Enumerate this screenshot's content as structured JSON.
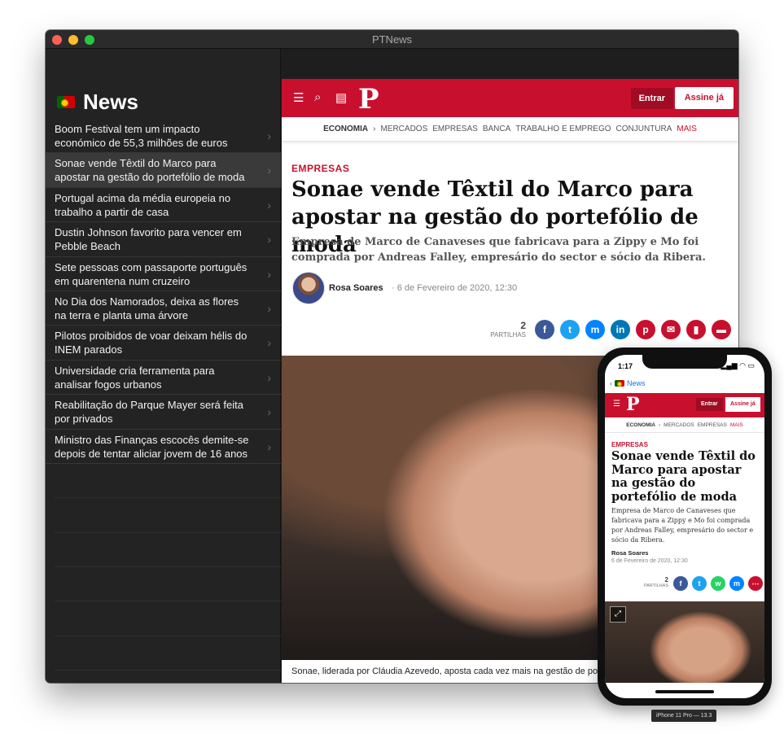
{
  "window": {
    "title": "PTNews"
  },
  "colors": {
    "brand_red": "#c8102e",
    "sidebar_bg": "#232323"
  },
  "sidebar": {
    "title": "News",
    "items": [
      {
        "label": "Boom Festival tem um impacto económico de 55,3 milhões de euros"
      },
      {
        "label": "Sonae vende Têxtil do Marco para apostar na gestão do portefólio de moda",
        "selected": true
      },
      {
        "label": "Portugal acima da média europeia no trabalho a partir de casa"
      },
      {
        "label": "Dustin Johnson favorito para vencer em Pebble Beach"
      },
      {
        "label": "Sete pessoas com passaporte português em quarentena num cruzeiro"
      },
      {
        "label": "No Dia dos Namorados, deixa as flores na terra e planta uma árvore"
      },
      {
        "label": "Pilotos proibidos de voar deixam hélis do INEM parados"
      },
      {
        "label": "Universidade cria ferramenta para analisar fogos urbanos"
      },
      {
        "label": "Reabilitação do Parque Mayer será feita por privados"
      },
      {
        "label": "Ministro das Finanças escocês demite-se depois de tentar aliciar jovem de 16 anos"
      }
    ]
  },
  "site": {
    "logo": "P",
    "entrar": "Entrar",
    "assine": "Assine já",
    "subnav": [
      "ECONOMIA",
      "›",
      "MERCADOS",
      "EMPRESAS",
      "BANCA",
      "TRABALHO E EMPREGO",
      "CONJUNTURA",
      "MAIS"
    ]
  },
  "article": {
    "kicker": "EMPRESAS",
    "headline": "Sonae vende Têxtil do Marco para apostar na gestão do portefólio de moda",
    "standfirst": "Empresa de Marco de Canaveses que fabricava para a Zippy e Mo foi comprada por Andreas Falley, empresário do sector e sócio da Ribera.",
    "author": "Rosa Soares",
    "date": "· 6 de Fevereiro de 2020, 12:30",
    "share_count": "2",
    "share_label": "PARTILHAS",
    "caption": "Sonae, liderada por Cláudia Azevedo, aposta cada vez mais na gestão de po"
  },
  "phone": {
    "time": "1:17",
    "status": "▂▄▆ ◠ ▭",
    "back_label": "News",
    "subnav": [
      "ECONOMIA",
      "›",
      "MERCADOS",
      "EMPRESAS",
      "MAIS"
    ],
    "author": "Rosa Soares",
    "date": "6 de Fevereiro de 2020, 12:30",
    "device_label": "iPhone 11 Pro — 13.3"
  },
  "icons": {
    "share_desktop": [
      "facebook-icon",
      "twitter-icon",
      "messenger-icon",
      "linkedin-icon",
      "pinterest-icon",
      "email-icon",
      "bookmark-icon",
      "comment-icon"
    ],
    "share_phone": [
      "facebook-icon",
      "twitter-icon",
      "whatsapp-icon",
      "messenger-icon",
      "more-icon"
    ]
  }
}
